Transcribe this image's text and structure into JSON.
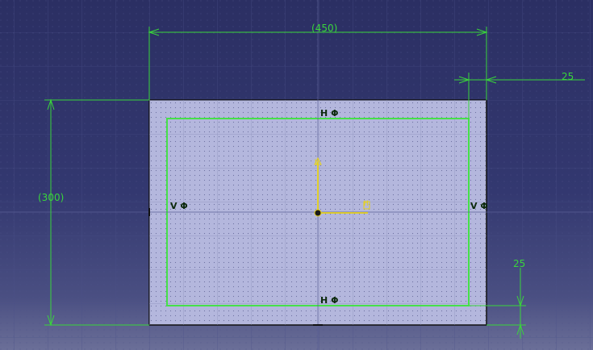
{
  "sketch": {
    "dimensions": {
      "width": "(450)",
      "height": "(300)",
      "offset_right": "25",
      "offset_bottom": "25"
    },
    "constraints": {
      "top": "H",
      "bottom": "H",
      "left": "V",
      "right": "V",
      "symbol": "Φ"
    },
    "axes": {
      "v_label": "V",
      "h_label": "H"
    },
    "colors": {
      "background_top": "#2b2f63",
      "plate_fill": "#b3b6dc",
      "profile": "#46e04a",
      "dimension": "#39d53b",
      "axis": "#e6d21a",
      "grid": "#5a5f95"
    }
  }
}
